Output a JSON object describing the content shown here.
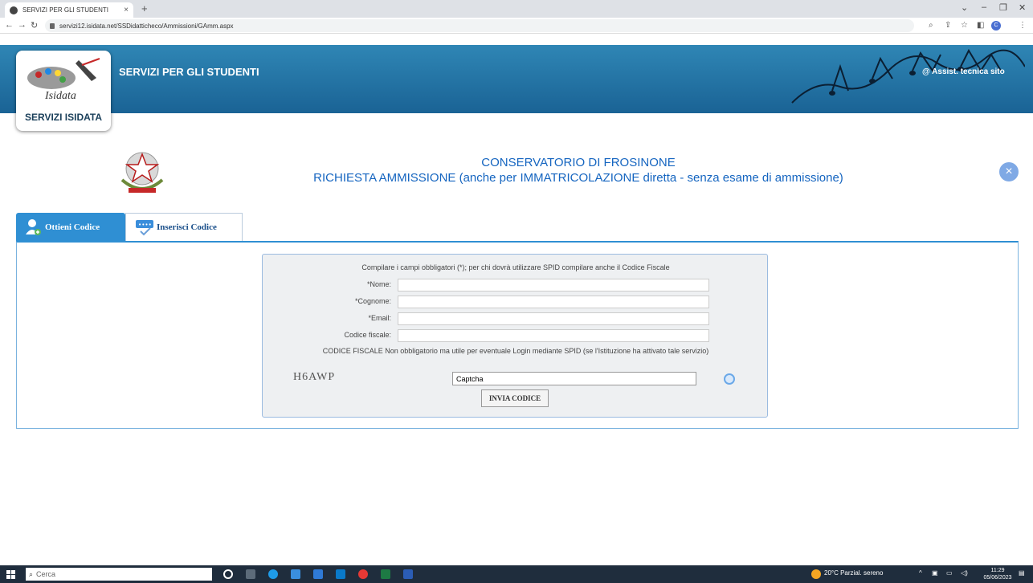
{
  "browser": {
    "tab_title": "SERVIZI PER GLI STUDENTI",
    "tab_close": "×",
    "new_tab": "+",
    "url": "servizi12.isidata.net/SSDidatticheco/Ammissioni/GAmm.aspx"
  },
  "header": {
    "logo_label": "SERVIZI ISIDATA",
    "logo_text": "Isidata",
    "title": "SERVIZI PER GLI STUDENTI",
    "assist_link": "@ Assist. tecnica sito"
  },
  "page": {
    "title_line1": "CONSERVATORIO DI FROSINONE",
    "title_line2": "RICHIESTA AMMISSIONE (anche per IMMATRICOLAZIONE diretta - senza esame di ammissione)",
    "close_symbol": "×"
  },
  "tabs": [
    {
      "label": "Ottieni Codice",
      "active": true
    },
    {
      "label": "Inserisci Codice",
      "active": false
    }
  ],
  "form": {
    "instructions": "Compilare i campi obbligatori (*); per chi dovrà utilizzare SPID compilare anche il Codice Fiscale",
    "fields": [
      {
        "label": "*Nome:",
        "value": ""
      },
      {
        "label": "*Cognome:",
        "value": ""
      },
      {
        "label": "*Email:",
        "value": ""
      },
      {
        "label": "Codice fiscale:",
        "value": ""
      }
    ],
    "cf_note": "CODICE FISCALE Non obbligatorio ma utile per eventuale Login mediante SPID (se l'Istituzione ha attivato tale servizio)",
    "captcha_code": "H6AWP",
    "captcha_value": "Captcha",
    "submit_label": "INVIA CODICE"
  },
  "taskbar": {
    "search_placeholder": "Cerca",
    "weather": "20°C Parzial. sereno",
    "time": "11:29",
    "date": "05/06/2023"
  },
  "colors": {
    "header_blue": "#1a6395",
    "title_blue": "#1565c0",
    "tab_active": "#2f8fd3"
  }
}
